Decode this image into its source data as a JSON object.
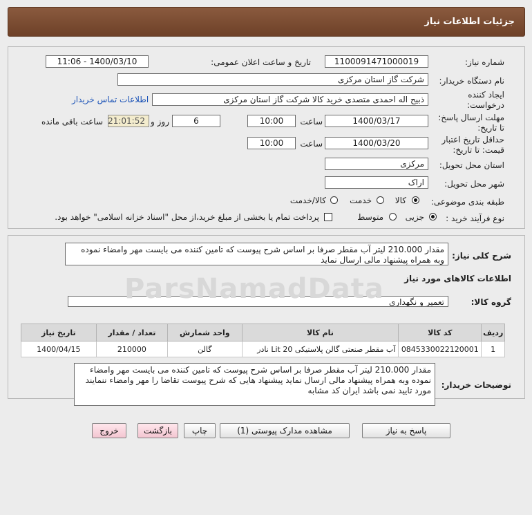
{
  "header": {
    "title": "جزئیات اطلاعات نیاز"
  },
  "form": {
    "need_number": {
      "label": "شماره نیاز:",
      "value": "1100091471000019"
    },
    "announce_datetime": {
      "label": "تاریخ و ساعت اعلان عمومی:",
      "value": "1400/03/10 - 11:06"
    },
    "buyer_org": {
      "label": "نام دستگاه خریدار:",
      "value": "شرکت گاز استان مرکزی"
    },
    "requester": {
      "label_line1": "ایجاد کننده",
      "label_line2": "درخواست:",
      "value": "ذبیح اله احمدی متصدی خرید کالا شرکت گاز استان مرکزی",
      "contact_link": "اطلاعات تماس خریدار"
    },
    "reply_deadline": {
      "label_line1": "مهلت ارسال پاسخ:",
      "label_line2": "تا تاریخ:",
      "date": "1400/03/17",
      "time_label": "ساعت",
      "time": "10:00",
      "days": "6",
      "days_label": "روز و",
      "remaining_time": "21:01:52",
      "remaining_label": "ساعت باقی مانده"
    },
    "price_validity": {
      "label_line1": "حداقل تاریخ اعتبار",
      "label_line2": "قیمت: تا تاریخ:",
      "date": "1400/03/20",
      "time_label": "ساعت",
      "time": "10:00"
    },
    "delivery_province": {
      "label": "استان محل تحویل:",
      "value": "مرکزی"
    },
    "delivery_city": {
      "label": "شهر محل تحویل:",
      "value": "اراک"
    },
    "category": {
      "label": "طبقه بندی موضوعی:",
      "options": [
        "کالا",
        "خدمت",
        "کالا/خدمت"
      ],
      "selected": "کالا"
    },
    "purchase_process": {
      "label": "نوع فرآیند خرید :",
      "options": [
        "جزیی",
        "متوسط"
      ],
      "selected": "جزیی",
      "payment_note": "پرداخت تمام یا بخشی از مبلغ خرید،از محل \"اسناد خزانه اسلامی\" خواهد بود."
    }
  },
  "description": {
    "label": "شرح کلی نیاز:",
    "text": "مقدار 210.000 لیتر آب مقطر صرفا بر اساس شرح پیوست که تامین کننده می بایست مهر وامضاء نموده وبه همراه پیشنهاد مالی ارسال نماید"
  },
  "goods_info": {
    "title": "اطلاعات کالاهای مورد نیاز",
    "group_label": "گروه کالا:",
    "group_value": "تعمیر و نگهداری"
  },
  "table": {
    "headers": [
      "ردیف",
      "کد کالا",
      "نام کالا",
      "واحد شمارش",
      "تعداد / مقدار",
      "تاریخ نیاز"
    ],
    "rows": [
      [
        "1",
        "0845330022120001",
        "آب مقطر صنعتی گالن پلاستیکی 20 Lit نادر",
        "گالن",
        "210000",
        "1400/04/15"
      ]
    ]
  },
  "buyer_notes": {
    "label": "توضیحات خریدار:",
    "text": "مقدار 210.000 لیتر آب مقطر صرفا بر اساس شرح پیوست که تامین کننده می بایست مهر وامضاء نموده وبه همراه پیشنهاد مالی ارسال نماید پیشنهاد هایی که شرح پیوست تقاضا را مهر وامضاء ننمایند مورد تایید نمی باشد ایران کد مشابه"
  },
  "buttons": {
    "reply": "پاسخ به نیاز",
    "attachments": "مشاهده مدارک پیوستی (1)",
    "print": "چاپ",
    "back": "بازگشت",
    "exit": "خروج"
  },
  "watermark": "ParsNamadData"
}
